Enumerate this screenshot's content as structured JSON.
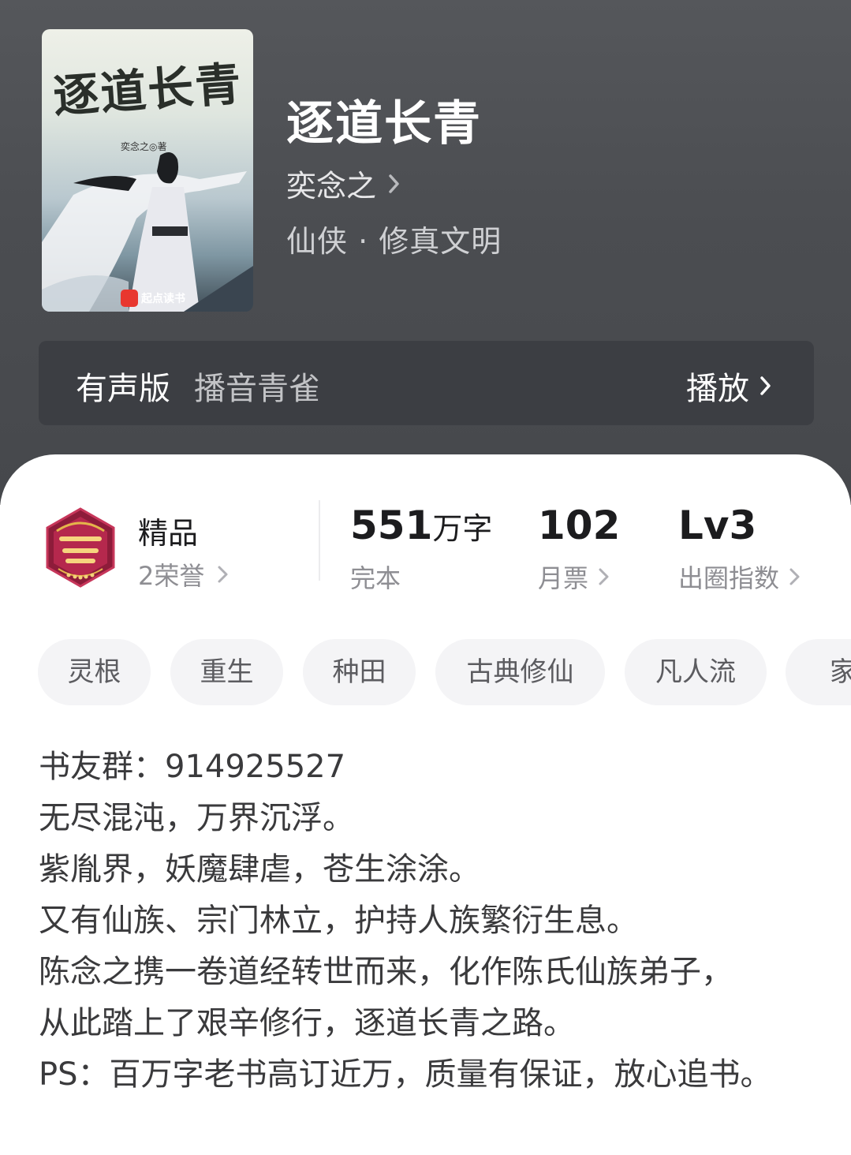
{
  "book": {
    "title": "逐道长青",
    "author": "奕念之",
    "genre": "仙侠 · 修真文明",
    "cover": {
      "title_text": "逐道长青",
      "author_text": "奕念之◎著",
      "publisher_text": "起点读书"
    }
  },
  "audio": {
    "label": "有声版",
    "narrator": "播音青雀",
    "play_label": "播放"
  },
  "stats": {
    "quality": {
      "label": "精品",
      "honors": "2荣誉"
    },
    "words": {
      "value": "551",
      "unit": "万字",
      "status": "完本"
    },
    "monthly_tickets": {
      "value": "102",
      "label": "月票"
    },
    "popularity": {
      "value": "Lv3",
      "label": "出圈指数"
    }
  },
  "tags": [
    "灵根",
    "重生",
    "种田",
    "古典修仙",
    "凡人流",
    "家族"
  ],
  "description": [
    "书友群：914925527",
    "无尽混沌，万界沉浮。",
    "紫胤界，妖魔肆虐，苍生涂涂。",
    "又有仙族、宗门林立，护持人族繁衍生息。",
    "陈念之携一卷道经转世而来，化作陈氏仙族弟子，从此踏上了艰辛修行，逐道长青之路。",
    "PS：百万字老书高订近万，质量有保证，放心追书。"
  ],
  "colors": {
    "header_bg": "#4b4d51",
    "audio_bar_bg": "#3c3e43",
    "tag_bg": "#f4f4f6"
  }
}
